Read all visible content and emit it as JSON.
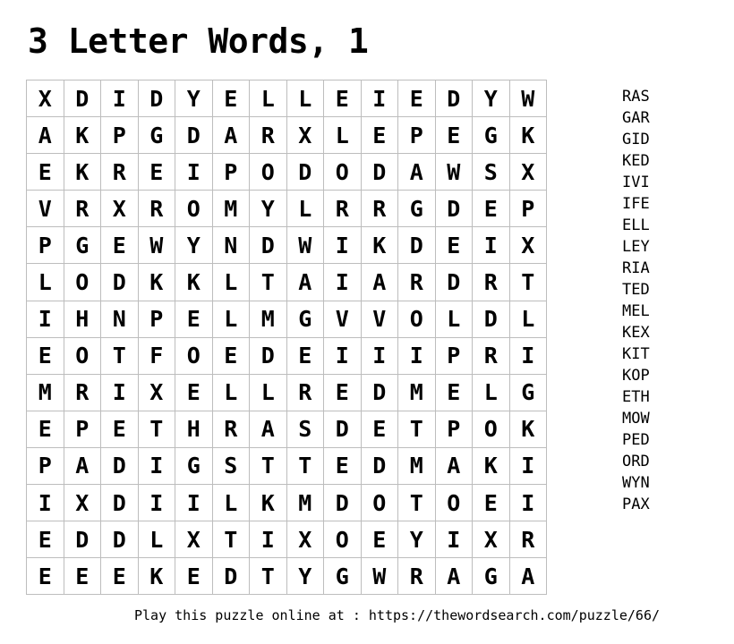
{
  "title": "3 Letter Words, 1",
  "grid": [
    [
      "X",
      "D",
      "I",
      "D",
      "Y",
      "E",
      "L",
      "L",
      "E",
      "I",
      "E",
      "D",
      "Y",
      "W"
    ],
    [
      "A",
      "K",
      "P",
      "G",
      "D",
      "A",
      "R",
      "X",
      "L",
      "E",
      "P",
      "E",
      "G",
      "K"
    ],
    [
      "E",
      "K",
      "R",
      "E",
      "I",
      "P",
      "O",
      "D",
      "O",
      "D",
      "A",
      "W",
      "S",
      "X"
    ],
    [
      "V",
      "R",
      "X",
      "R",
      "O",
      "M",
      "Y",
      "L",
      "R",
      "R",
      "G",
      "D",
      "E",
      "P"
    ],
    [
      "P",
      "G",
      "E",
      "W",
      "Y",
      "N",
      "D",
      "W",
      "I",
      "K",
      "D",
      "E",
      "I",
      "X"
    ],
    [
      "L",
      "O",
      "D",
      "K",
      "K",
      "L",
      "T",
      "A",
      "I",
      "A",
      "R",
      "D",
      "R",
      "T"
    ],
    [
      "I",
      "H",
      "N",
      "P",
      "E",
      "L",
      "M",
      "G",
      "V",
      "V",
      "O",
      "L",
      "D",
      "L"
    ],
    [
      "E",
      "O",
      "T",
      "F",
      "O",
      "E",
      "D",
      "E",
      "I",
      "I",
      "I",
      "P",
      "R",
      "I"
    ],
    [
      "M",
      "R",
      "I",
      "X",
      "E",
      "L",
      "L",
      "R",
      "E",
      "D",
      "M",
      "E",
      "L",
      "G"
    ],
    [
      "E",
      "P",
      "E",
      "T",
      "H",
      "R",
      "A",
      "S",
      "D",
      "E",
      "T",
      "P",
      "O",
      "K"
    ],
    [
      "P",
      "A",
      "D",
      "I",
      "G",
      "S",
      "T",
      "T",
      "E",
      "D",
      "M",
      "A",
      "K",
      "I"
    ],
    [
      "I",
      "X",
      "D",
      "I",
      "I",
      "L",
      "K",
      "M",
      "D",
      "O",
      "T",
      "O",
      "E",
      "I"
    ],
    [
      "E",
      "D",
      "D",
      "L",
      "X",
      "T",
      "I",
      "X",
      "O",
      "E",
      "Y",
      "I",
      "X",
      "R"
    ],
    [
      "E",
      "E",
      "E",
      "K",
      "E",
      "D",
      "T",
      "Y",
      "G",
      "W",
      "R",
      "A",
      "G",
      "A"
    ]
  ],
  "words": [
    "RAS",
    "GAR",
    "GID",
    "KED",
    "IVI",
    "IFE",
    "ELL",
    "LEY",
    "RIA",
    "TED",
    "MEL",
    "KEX",
    "KIT",
    "KOP",
    "ETH",
    "MOW",
    "PED",
    "ORD",
    "WYN",
    "PAX"
  ],
  "footer": "Play this puzzle online at : https://thewordsearch.com/puzzle/66/"
}
